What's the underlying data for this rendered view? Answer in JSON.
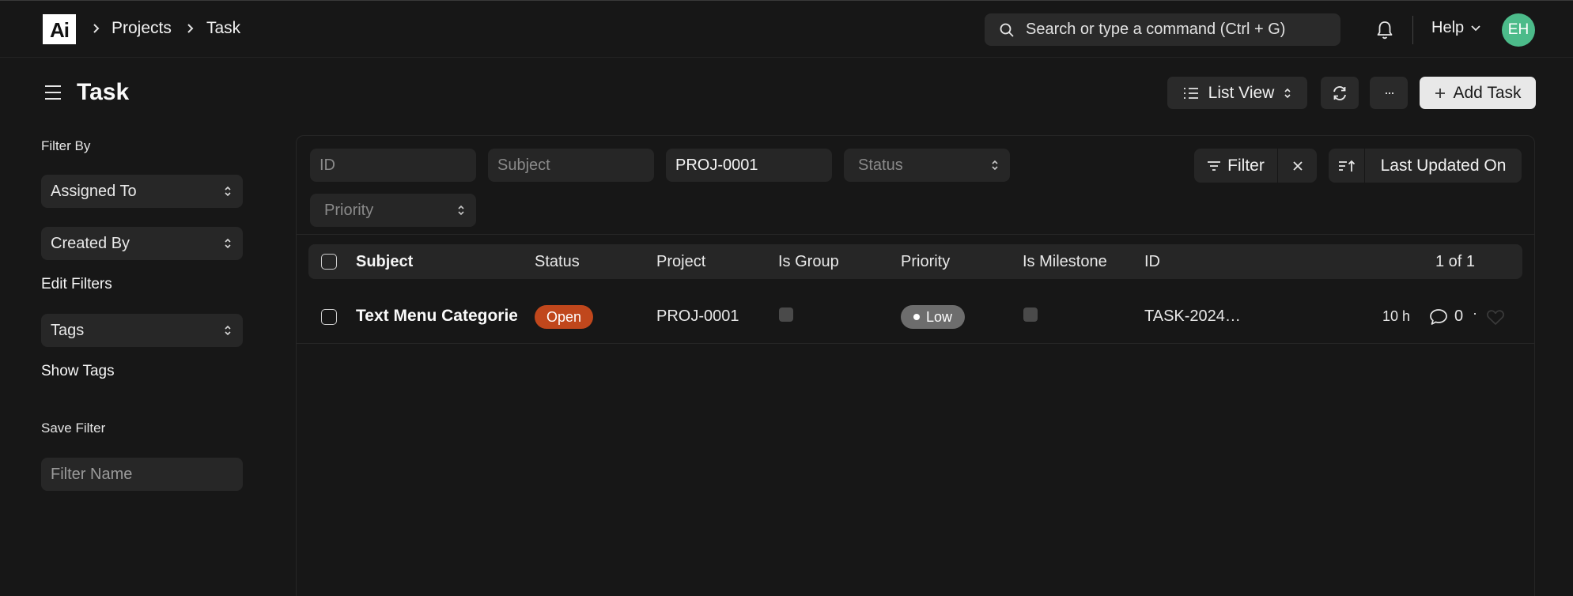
{
  "navbar": {
    "logo_text": "Ai",
    "breadcrumbs": [
      "Projects",
      "Task"
    ],
    "search_placeholder": "Search or type a command (Ctrl + G)",
    "help_label": "Help",
    "avatar_initials": "EH",
    "avatar_color": "#4cbb8a"
  },
  "page": {
    "title": "Task",
    "view_label": "List View",
    "more_label": "···",
    "add_label": "Add Task"
  },
  "sidebar": {
    "filter_by": "Filter By",
    "assigned_to": "Assigned To",
    "created_by": "Created By",
    "edit_filters": "Edit Filters",
    "tags": "Tags",
    "show_tags": "Show Tags",
    "save_filter": "Save Filter",
    "filter_name_placeholder": "Filter Name"
  },
  "filters": {
    "id_placeholder": "ID",
    "subject_placeholder": "Subject",
    "project_value": "PROJ-0001",
    "status_placeholder": "Status",
    "priority_placeholder": "Priority",
    "filter_label": "Filter",
    "sort_label": "Last Updated On"
  },
  "table": {
    "columns": {
      "subject": "Subject",
      "status": "Status",
      "project": "Project",
      "is_group": "Is Group",
      "priority": "Priority",
      "is_milestone": "Is Milestone",
      "id": "ID",
      "count": "1 of 1"
    },
    "rows": [
      {
        "subject": "Text Menu Categories",
        "status": "Open",
        "project": "PROJ-0001",
        "priority": "Low",
        "id": "TASK-2024…",
        "modified": "10 h",
        "comments": "0",
        "separator": "·"
      }
    ]
  },
  "colors": {
    "background": "#171717",
    "status_open": "#c0471c",
    "priority_low": "#6d6d6d"
  }
}
